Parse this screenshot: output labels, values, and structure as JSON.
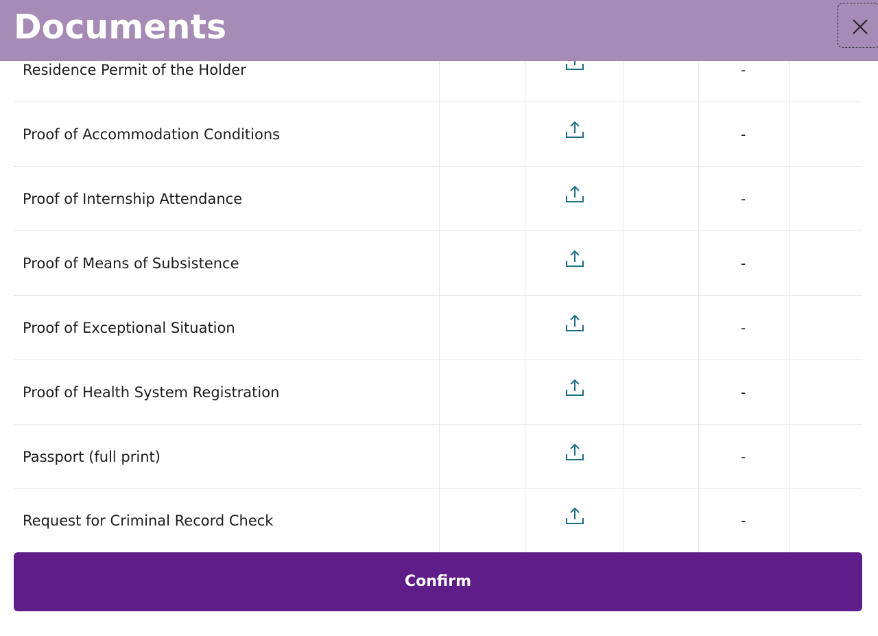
{
  "header": {
    "title": "Documents",
    "background_color": "#a58bb5"
  },
  "close_button": {
    "icon": "close-icon"
  },
  "documents": [
    {
      "name": "Residence Permit of the Holder",
      "status": "-",
      "upload_icon": "upload-icon"
    },
    {
      "name": "Proof of Accommodation Conditions",
      "status": "-",
      "upload_icon": "upload-icon"
    },
    {
      "name": "Proof of Internship Attendance",
      "status": "-",
      "upload_icon": "upload-icon"
    },
    {
      "name": "Proof of Means of Subsistence",
      "status": "-",
      "upload_icon": "upload-icon"
    },
    {
      "name": "Proof of Exceptional Situation",
      "status": "-",
      "upload_icon": "upload-icon"
    },
    {
      "name": "Proof of Health System Registration",
      "status": "-",
      "upload_icon": "upload-icon"
    },
    {
      "name": "Passport (full print)",
      "status": "-",
      "upload_icon": "upload-icon"
    },
    {
      "name": "Request for Criminal Record Check",
      "status": "-",
      "upload_icon": "upload-icon"
    }
  ],
  "confirm_button": {
    "label": "Confirm",
    "color": "#5e1d88"
  },
  "colors": {
    "upload_icon": "#1a6f8a",
    "grid_line": "#e6e6e6"
  }
}
